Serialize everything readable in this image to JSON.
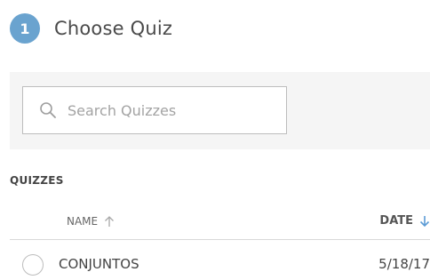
{
  "step": {
    "number": "1",
    "title": "Choose Quiz"
  },
  "search": {
    "placeholder": "Search Quizzes",
    "value": ""
  },
  "quizzes_section": {
    "label": "QUIZZES"
  },
  "columns": {
    "name_label": "NAME",
    "date_label": "DATE"
  },
  "rows": [
    {
      "name": "CONJUNTOS",
      "date": "5/18/17",
      "selected": false
    }
  ],
  "colors": {
    "accent": "#6aa3cf",
    "sort_active": "#5b9bd5",
    "sort_inactive": "#a8a8a8"
  },
  "icons": {
    "search": "search-icon",
    "sort_up": "arrow-up-icon",
    "sort_down": "arrow-down-icon"
  }
}
